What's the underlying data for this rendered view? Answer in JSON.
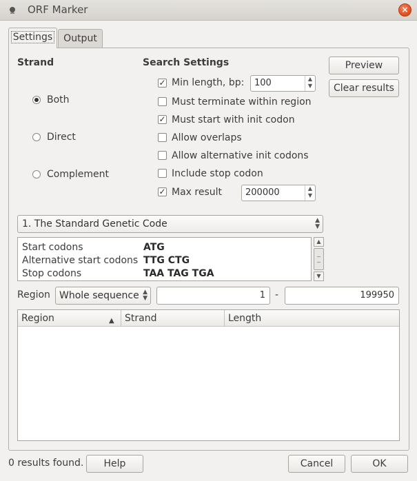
{
  "window": {
    "title": "ORF Marker",
    "close_glyph": "×"
  },
  "tabs": [
    {
      "label": "Settings"
    },
    {
      "label": "Output"
    }
  ],
  "strand": {
    "heading": "Strand",
    "options": [
      {
        "label": "Both",
        "selected": true
      },
      {
        "label": "Direct",
        "selected": false
      },
      {
        "label": "Complement",
        "selected": false
      }
    ]
  },
  "search": {
    "heading": "Search Settings",
    "min_length": {
      "label": "Min length, bp:",
      "checked": true,
      "value": "100"
    },
    "must_terminate": {
      "label": "Must terminate within region",
      "checked": false
    },
    "must_start": {
      "label": "Must start with init codon",
      "checked": true
    },
    "allow_overlaps": {
      "label": "Allow overlaps",
      "checked": false
    },
    "allow_alt_init": {
      "label": "Allow alternative init codons",
      "checked": false
    },
    "include_stop": {
      "label": "Include stop codon",
      "checked": false
    },
    "max_result": {
      "label": "Max result",
      "checked": true,
      "value": "200000"
    }
  },
  "actions": {
    "preview": "Preview",
    "clear_results": "Clear results"
  },
  "genetic_code": {
    "selected": "1. The Standard Genetic Code"
  },
  "codons": [
    {
      "key": "Start codons",
      "value": "ATG"
    },
    {
      "key": "Alternative start codons",
      "value": "TTG CTG"
    },
    {
      "key": "Stop codons",
      "value": "TAA TAG TGA"
    }
  ],
  "region": {
    "label": "Region",
    "mode": "Whole sequence",
    "start": "1",
    "separator": "-",
    "end": "199950"
  },
  "results_table": {
    "columns": [
      "Region",
      "Strand",
      "Length"
    ],
    "rows": []
  },
  "footer": {
    "status": "0 results found.",
    "help": "Help",
    "cancel": "Cancel",
    "ok": "OK"
  }
}
